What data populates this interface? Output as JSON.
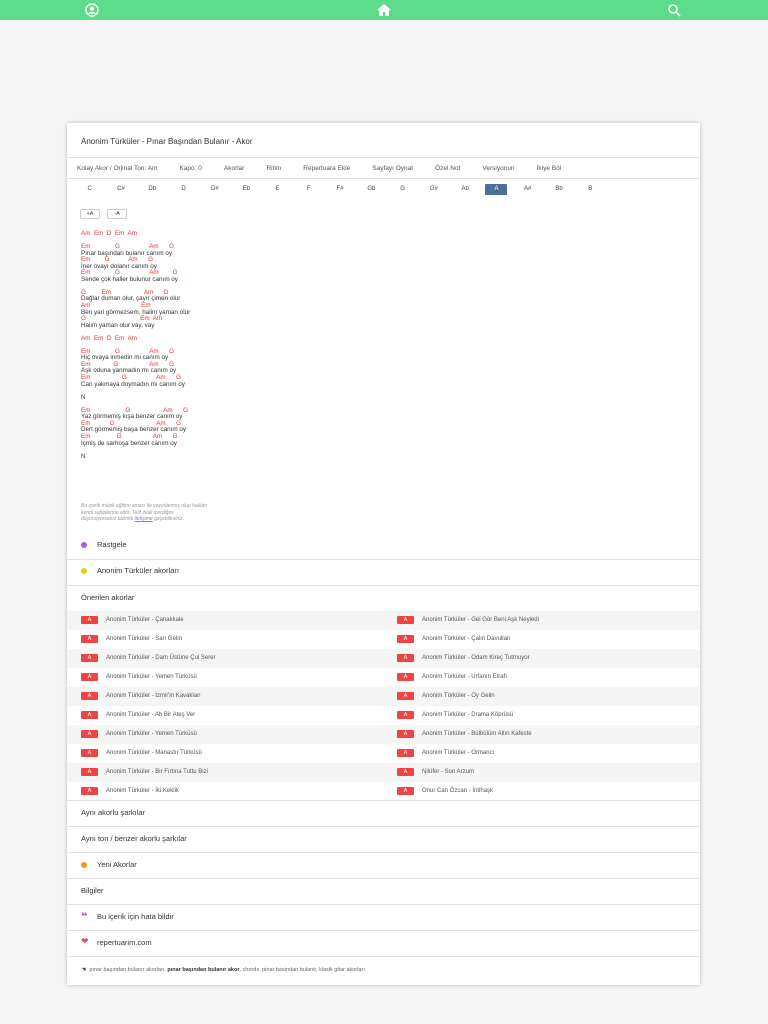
{
  "topbar": {
    "user_icon": "user-circle-icon",
    "home_icon": "home-icon",
    "search_icon": "search-icon",
    "color": "#5cdc8c"
  },
  "title": "Anonim Türküler - Pınar Başından Bulanır - Akor",
  "options": [
    "Kolay Akor / Orjinal Ton: Am",
    "Kapo: 0",
    "Akorlar",
    "Ritim",
    "Repertuara Ekle",
    "Sayfayı Oynat",
    "Özel Not",
    "Versiyonun",
    "İkiye Böl"
  ],
  "keys": [
    "C",
    "C#",
    "Db",
    "D",
    "D#",
    "Eb",
    "E",
    "F",
    "F#",
    "Gb",
    "G",
    "G#",
    "Ab",
    "A",
    "A#",
    "Bb",
    "B"
  ],
  "active_key": "A",
  "size_buttons": [
    "+A",
    "-A"
  ],
  "lyrics": [
    {
      "c": "Am  Em  D  Em  Am"
    },
    {
      "t": ""
    },
    {
      "c": "Em              G                 Am      G"
    },
    {
      "t": "Pınar başından bulanır canım oy"
    },
    {
      "c": "Em        G           Am      G"
    },
    {
      "t": "İner ovayı dolanır canım oy"
    },
    {
      "c": "Em              G                 Am        G"
    },
    {
      "t": "Sende çok haller bulunur canım oy"
    },
    {
      "t": ""
    },
    {
      "c": "G         Em                   Am      D"
    },
    {
      "t": "Dağlar duman olur, çayır çimen olur"
    },
    {
      "c": "Am                             Em"
    },
    {
      "t": "Ben yari görmezsem, halim yaman olur"
    },
    {
      "c": "G                               Em  Am"
    },
    {
      "t": "Halim yaman olur vay, vay"
    },
    {
      "t": ""
    },
    {
      "c": "Am  Em  D  Em  Am"
    },
    {
      "t": ""
    },
    {
      "c": "Em              G                 Am      G"
    },
    {
      "t": "Hiç ovaya inmedin mi canım oy"
    },
    {
      "c": "Em             G                  Am      G"
    },
    {
      "t": "Aşk oduna yanmadın mı canım oy"
    },
    {
      "c": "Em                  G                 Am      G"
    },
    {
      "t": "Can yakmaya doymadın mı canım oy"
    },
    {
      "t": ""
    },
    {
      "t": "N"
    },
    {
      "t": ""
    },
    {
      "c": "Em                    G                   Am      G"
    },
    {
      "t": "Yaz görmemiş kışa benzer canım oy"
    },
    {
      "c": "Em           G                        Am      G"
    },
    {
      "t": "Dert görmemiş başa benzer canım oy"
    },
    {
      "c": "Em               G                  Am      G"
    },
    {
      "t": "İçmiş de sarhoşa benzer canım oy"
    },
    {
      "t": ""
    },
    {
      "t": "N"
    }
  ],
  "note": {
    "line1": "Bu içerik müzik eğitimi amacı ile yayınlanmış olup hakları",
    "line2": "kendi sahiplerine aittir. Telif ihlali içerdiğini",
    "line3_pre": "düşünüyorsanız bizimle ",
    "line3_link": "iletişime",
    "line3_post": " geçebilirsiniz."
  },
  "sections": {
    "random": {
      "label": "Rastgele",
      "color": "#b15ad6"
    },
    "artist": {
      "label": "Anonim Türküler akorları",
      "color": "#f2c80f"
    },
    "suggested_title": "Önerilen akorlar",
    "same_chords": "Aynı akorlu şarkılar",
    "same_key": "Aynı ton / benzer akorlu şarkılar",
    "new": {
      "label": "Yeni Akorlar",
      "color": "#f39b1b"
    },
    "info": "Bilgiler",
    "report": {
      "label": "Bu içerik için hata bildir",
      "color": "#c04ad4",
      "icon": "quote-icon"
    },
    "site": {
      "label": "repertuarim.com",
      "color": "#e84b4b",
      "icon": "heart-icon"
    }
  },
  "badge_label": "A",
  "suggested": [
    [
      "Anonim Türküler - Çanakkale",
      "Anonim Türküler - Gel Gör Beni Aşk Neyledi"
    ],
    [
      "Anonim Türküler - Sarı Gelin",
      "Anonim Türküler - Çalın Davulları"
    ],
    [
      "Anonim Türküler - Dam Üstüne Çul Serer",
      "Anonim Türküler - Odam Kireç Tutmuyor"
    ],
    [
      "Anonim Türküler - Yemen Türküsü",
      "Anonim Türküler - Urfanın Etrafı"
    ],
    [
      "Anonim Türküler - İzmir'in Kavakları",
      "Anonim Türküler - Oy Gelin"
    ],
    [
      "Anonim Türküler - Ah Bir Ateş Ver",
      "Anonim Türküler - Drama Köprüsü"
    ],
    [
      "Anonim Türküler - Yemen Türküsü",
      "Anonim Türküler - Bülbülüm Altın Kafeste"
    ],
    [
      "Anonim Türküler - Manastır Türküsü",
      "Anonim Türküler - Ormancı"
    ],
    [
      "Anonim Türküler - Bir Fırtına Tuttu Bizi",
      "Nilüfer - Son Arzum"
    ],
    [
      "Anonim Türküler - İki Keklik",
      "Onur Can Özcan - İntihaşk"
    ]
  ],
  "tags": {
    "pre": "pınar başından bulanır akorları, ",
    "bold": "pınar başından bulanır akor",
    "post": ", chords, pinar basindan bulanir, klasik gitar akorları",
    "icon": "tag-icon"
  }
}
